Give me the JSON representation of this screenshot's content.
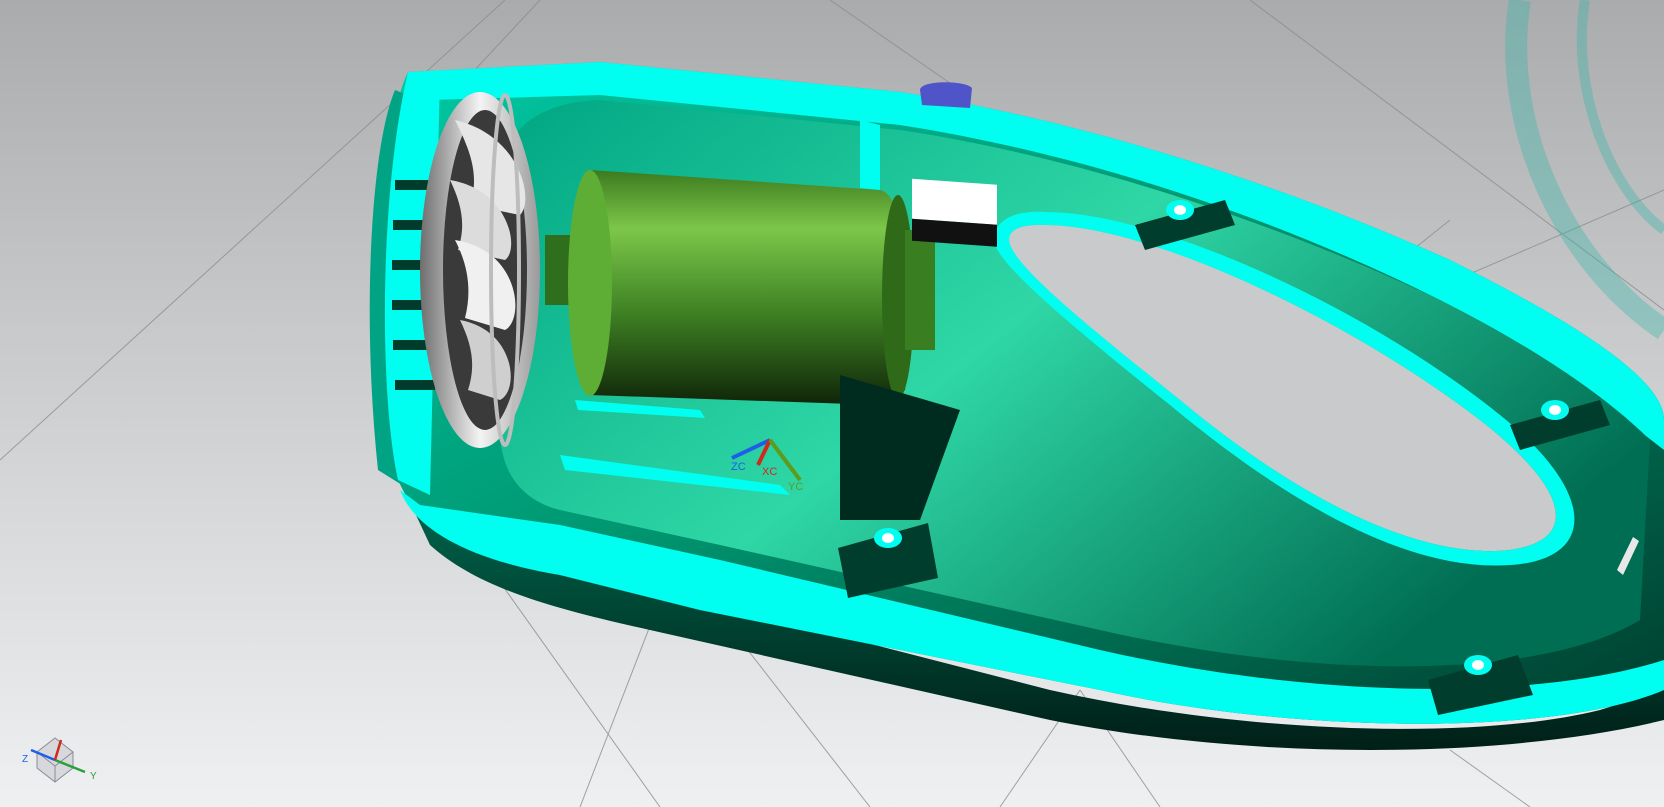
{
  "viewport": {
    "background_top": "#a9abad",
    "background_bottom": "#eef0f1"
  },
  "colors": {
    "housing_face": "#00ffee",
    "housing_shade": "#009a78",
    "housing_dark": "#003a2c",
    "motor": "#4f9a2c",
    "impeller": "#d8d8d8",
    "switch_cap": "#4f55c8",
    "grid_line": "#8a8c8e"
  },
  "wcs_triad": {
    "labels": {
      "z": "ZC",
      "x": "XC",
      "y": "YC"
    },
    "colors": {
      "z": "#1f5fe8",
      "x": "#d02a1c",
      "y": "#5e9a1c"
    }
  },
  "view_triad": {
    "labels": {
      "z": "Z",
      "y": "Y"
    },
    "colors": {
      "z": "#1f5fe8",
      "y": "#2aa03a"
    }
  },
  "model": {
    "parts": [
      "housing-half",
      "motor",
      "impeller",
      "switch-button",
      "screw-bosses"
    ]
  }
}
